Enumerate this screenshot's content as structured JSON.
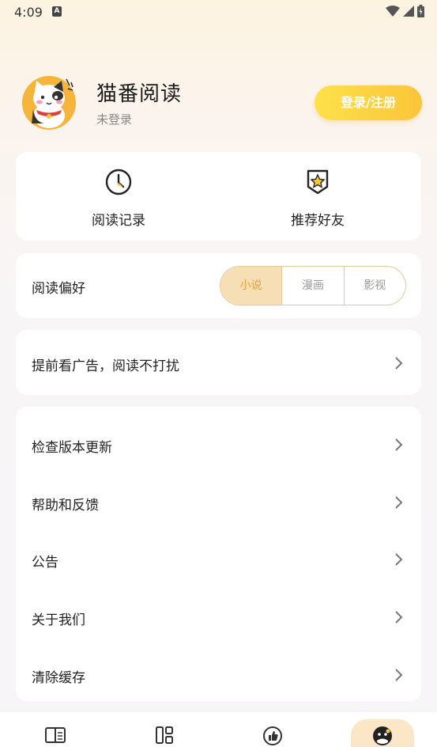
{
  "status_bar": {
    "time": "4:09",
    "notification_icon": "A"
  },
  "profile": {
    "app_name": "猫番阅读",
    "login_status": "未登录",
    "login_button": "登录/注册"
  },
  "quick_actions": [
    {
      "label": "阅读记录",
      "icon": "clock-icon"
    },
    {
      "label": "推荐好友",
      "icon": "star-badge-icon"
    }
  ],
  "reading_preference": {
    "label": "阅读偏好",
    "options": [
      "小说",
      "漫画",
      "影视"
    ],
    "selected": "小说"
  },
  "ad_row": {
    "label": "提前看广告，阅读不打扰"
  },
  "menu": [
    {
      "label": "检查版本更新"
    },
    {
      "label": "帮助和反馈"
    },
    {
      "label": "公告"
    },
    {
      "label": "关于我们"
    },
    {
      "label": "清除缓存"
    }
  ],
  "tabbar": {
    "tabs": [
      {
        "icon": "book-icon"
      },
      {
        "icon": "category-icon"
      },
      {
        "icon": "like-icon"
      },
      {
        "icon": "profile-icon"
      }
    ],
    "active_index": 3
  },
  "colors": {
    "accent": "#fcc43a",
    "accent_text": "#e2a33a",
    "segment_active_bg": "#f7dfb5"
  }
}
